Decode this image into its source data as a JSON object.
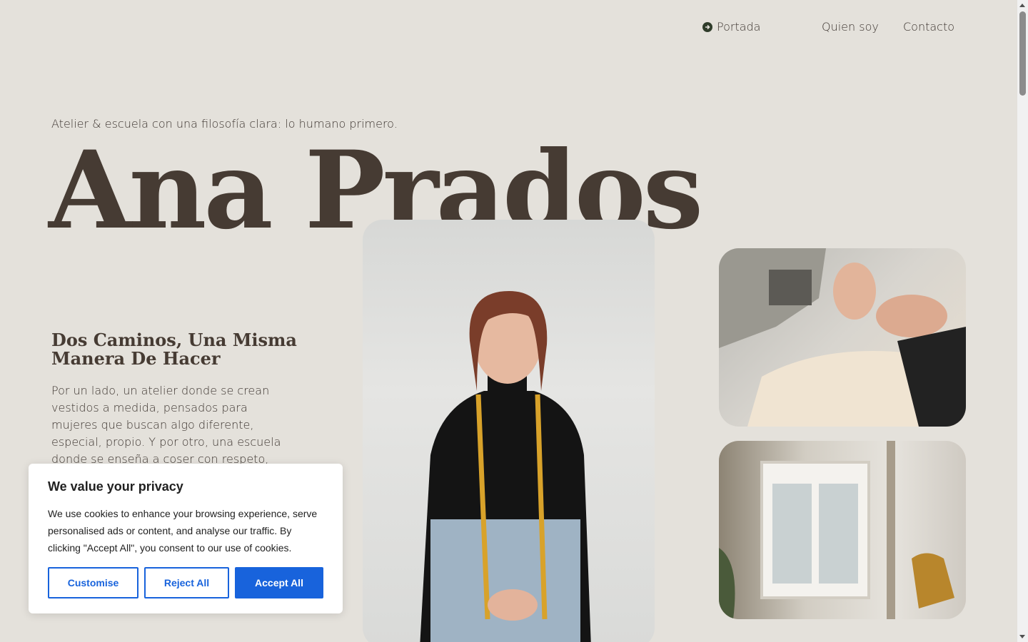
{
  "nav": {
    "items": [
      {
        "label": "Portada",
        "icon": "arrow-right-circle-icon",
        "active": true
      },
      {
        "label": "Quien soy"
      },
      {
        "label": "Contacto"
      }
    ]
  },
  "hero": {
    "tagline": "Atelier & escuela con una filosofía clara: lo humano primero.",
    "title": "Ana Prados"
  },
  "section": {
    "title": "Dos Caminos, Una Misma Manera De Hacer",
    "body": "Por un lado, un atelier donde se crean vestidos a medida, pensados para mujeres que buscan algo diferente, especial, propio. Y por otro, una escuela donde se enseña a coser con respeto, cercanía y sin prisas."
  },
  "cookie": {
    "title": "We value your privacy",
    "text": "We use cookies to enhance your browsing experience, serve personalised ads or content, and analyse our traffic. By clicking \"Accept All\", you consent to our use of cookies.",
    "customise": "Customise",
    "reject": "Reject All",
    "accept": "Accept All",
    "accent_color": "#1863dc"
  },
  "colors": {
    "background": "#e4e1db",
    "text": "#3d3530",
    "heading": "#463b33"
  }
}
